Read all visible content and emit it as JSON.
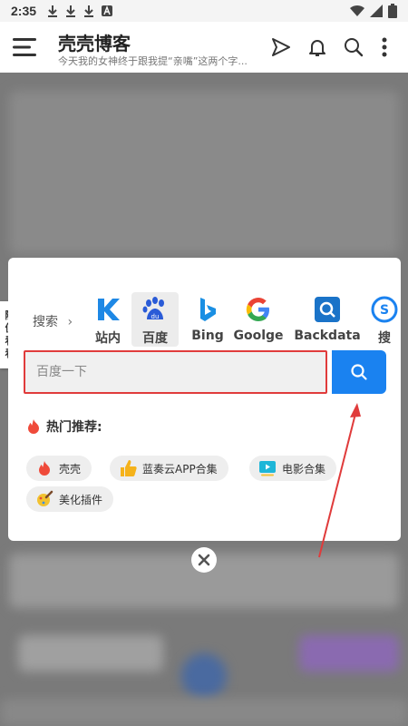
{
  "status_bar": {
    "time": "2:35"
  },
  "header": {
    "title": "壳壳博客",
    "subtitle": "今天我的女神终于跟我提“亲嘴”这两个字..."
  },
  "side_tab": {
    "chars": [
      "随",
      "便",
      "看",
      "看"
    ]
  },
  "search": {
    "label": "搜索",
    "placeholder": "百度一下",
    "engines": [
      {
        "name": "站内",
        "icon": "k-site-icon"
      },
      {
        "name": "百度",
        "icon": "baidu-paw-icon",
        "selected": true
      },
      {
        "name": "Bing",
        "icon": "bing-icon"
      },
      {
        "name": "Goolge",
        "icon": "google-icon"
      },
      {
        "name": "Backdata",
        "icon": "backdata-search-icon"
      },
      {
        "name": "搜",
        "icon": "sogou-icon"
      }
    ]
  },
  "hot": {
    "title": "热门推荐:",
    "tags": [
      {
        "label": "壳壳",
        "icon": "flame-icon"
      },
      {
        "label": "蓝奏云APP合集",
        "icon": "thumbs-up-icon"
      },
      {
        "label": "电影合集",
        "icon": "video-icon"
      },
      {
        "label": "美化插件",
        "icon": "paint-brush-icon"
      }
    ]
  },
  "colors": {
    "accent_blue": "#1a82f0",
    "highlight_red": "#e03b3b"
  }
}
